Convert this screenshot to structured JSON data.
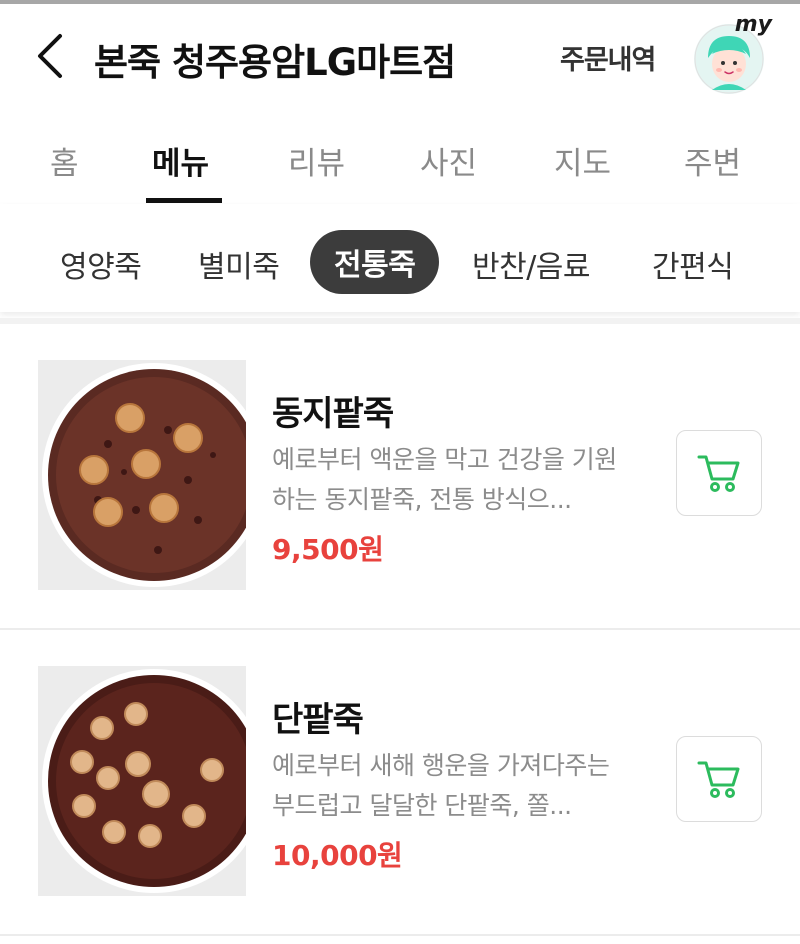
{
  "header": {
    "store_title": "본죽 청주용암LG마트점",
    "order_history": "주문내역",
    "avatar_badge": "my"
  },
  "tabs": [
    {
      "label": "홈"
    },
    {
      "label": "메뉴",
      "active": true
    },
    {
      "label": "리뷰"
    },
    {
      "label": "사진"
    },
    {
      "label": "지도"
    },
    {
      "label": "주변"
    }
  ],
  "categories": [
    {
      "label": "영양죽"
    },
    {
      "label": "별미죽"
    },
    {
      "label": "전통죽",
      "active": true
    },
    {
      "label": "반찬/음료"
    },
    {
      "label": "간편식"
    }
  ],
  "menu_items": [
    {
      "name": "동지팥죽",
      "description": "예로부터 액운을 막고 건강을 기원하는 동지팥죽, 전통 방식으...",
      "price": "9,500원",
      "image": "red-bean-porridge-with-rice-balls"
    },
    {
      "name": "단팥죽",
      "description": "예로부터 새해 행운을 가져다주는 부드럽고 달달한 단팥죽, 쫄...",
      "price": "10,000원",
      "image": "sweet-red-bean-porridge-with-rice-balls"
    }
  ],
  "colors": {
    "accent_green": "#2cbb5d",
    "price_red": "#e8423d",
    "active_pill": "#3c3c3c"
  },
  "icons": {
    "back": "chevron-left-icon",
    "cart": "cart-icon"
  }
}
